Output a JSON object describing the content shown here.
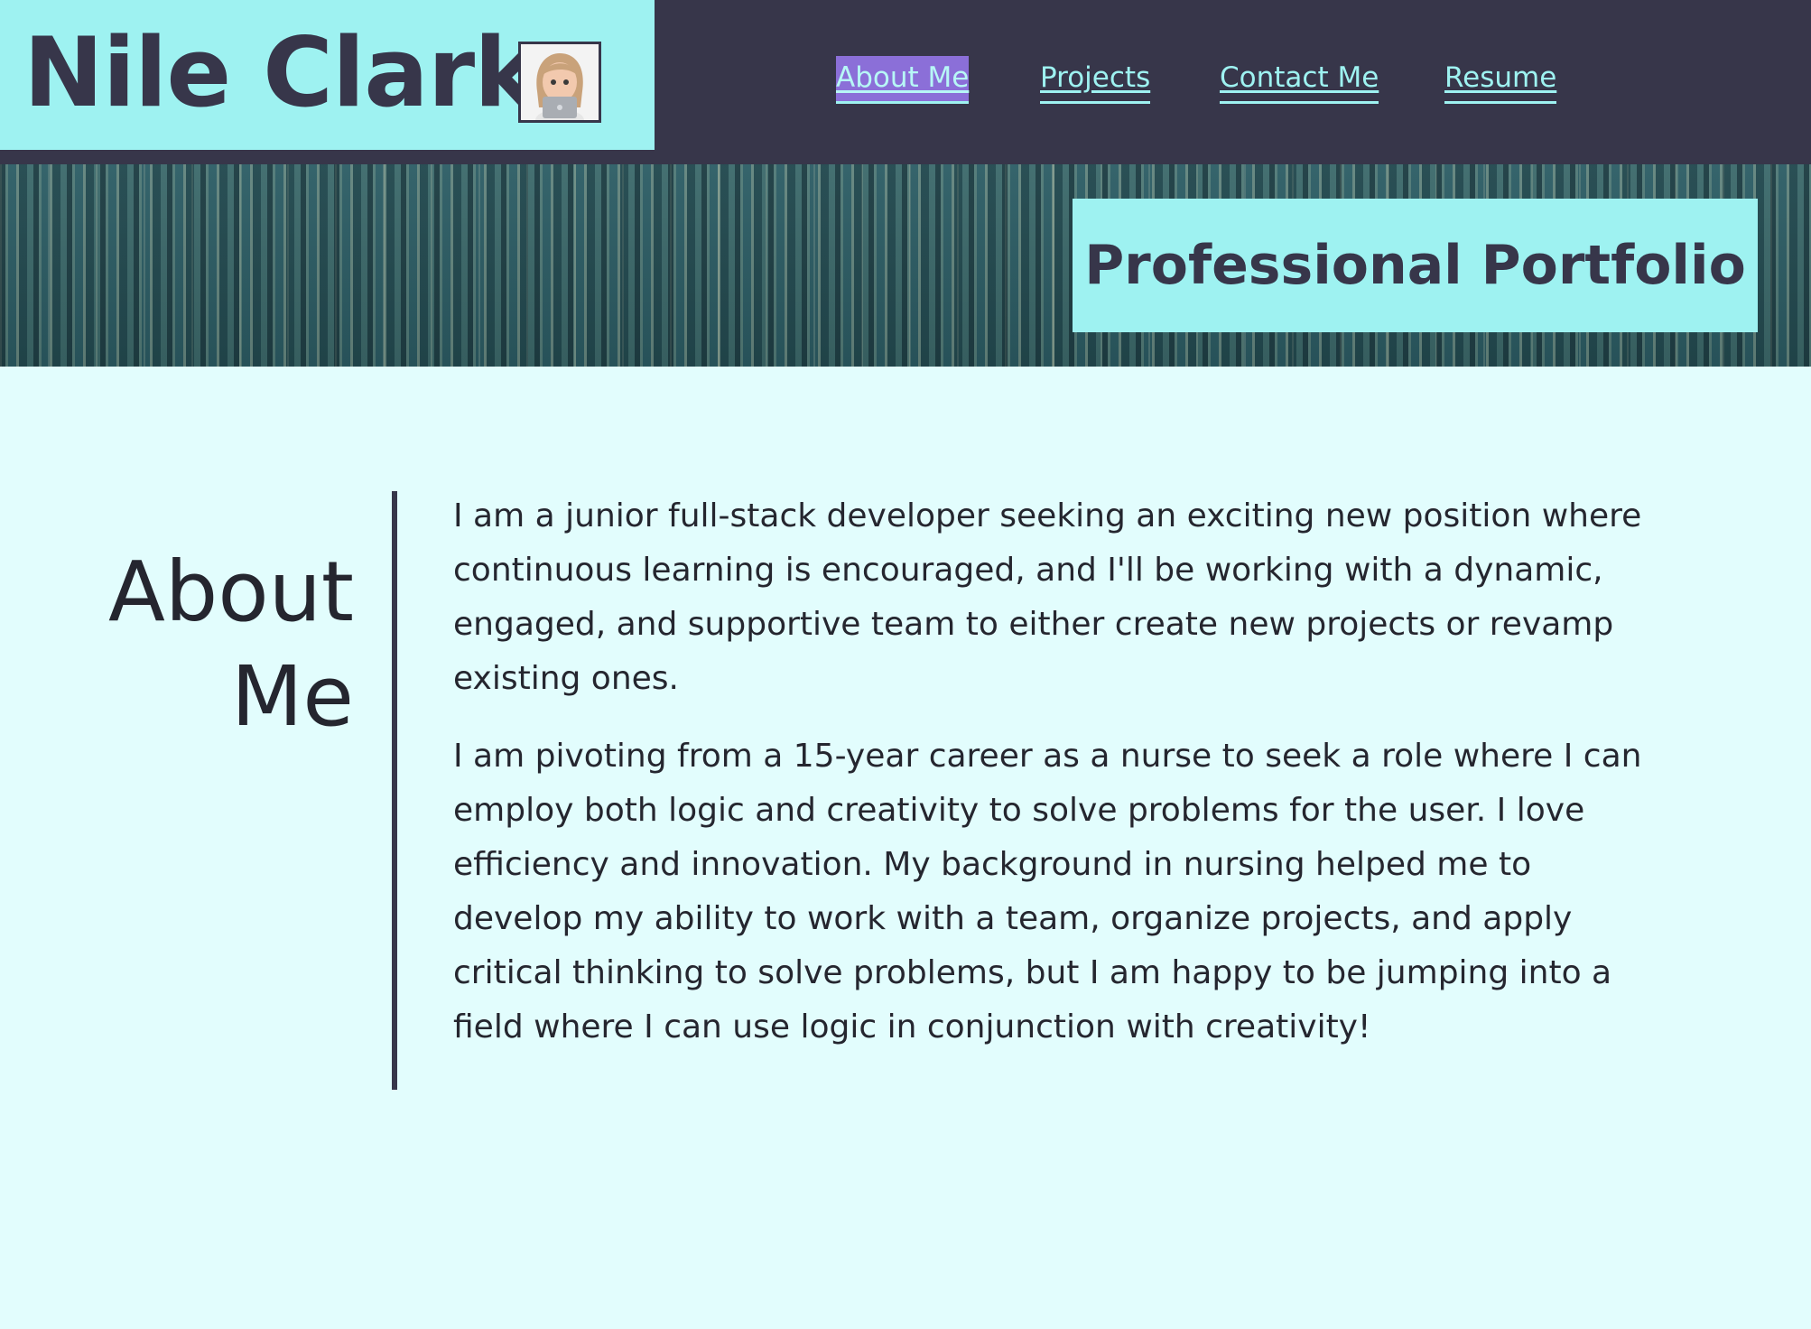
{
  "header": {
    "name": "Nile Clark",
    "avatar_alt": "memoji avatar with laptop"
  },
  "nav": {
    "items": [
      {
        "label": "About Me",
        "active": true
      },
      {
        "label": "Projects",
        "active": false
      },
      {
        "label": "Contact Me",
        "active": false
      },
      {
        "label": "Resume",
        "active": false
      }
    ]
  },
  "hero": {
    "title": "Professional Portfolio"
  },
  "about": {
    "heading": "About Me",
    "paragraphs": [
      "I am a junior full-stack developer seeking an exciting new position where continuous learning is encouraged, and I'll be working with a dynamic, engaged, and supportive team to either create new projects or revamp existing ones.",
      "I am pivoting from a 15-year career as a nurse to seek a role where I can employ both logic and creativity to solve problems for the user. I love efficiency and innovation. My background in nursing helped me to develop my ability to work with a team, organize projects, and apply critical thinking to solve problems, but I am happy to be jumping into a field where I can use logic in conjunction with creativity!"
    ]
  },
  "colors": {
    "nav_bg": "#37364a",
    "accent": "#9ef2f1",
    "page_bg": "#e2fdfd",
    "active_highlight": "#8b6fd8",
    "text": "#25262f"
  }
}
